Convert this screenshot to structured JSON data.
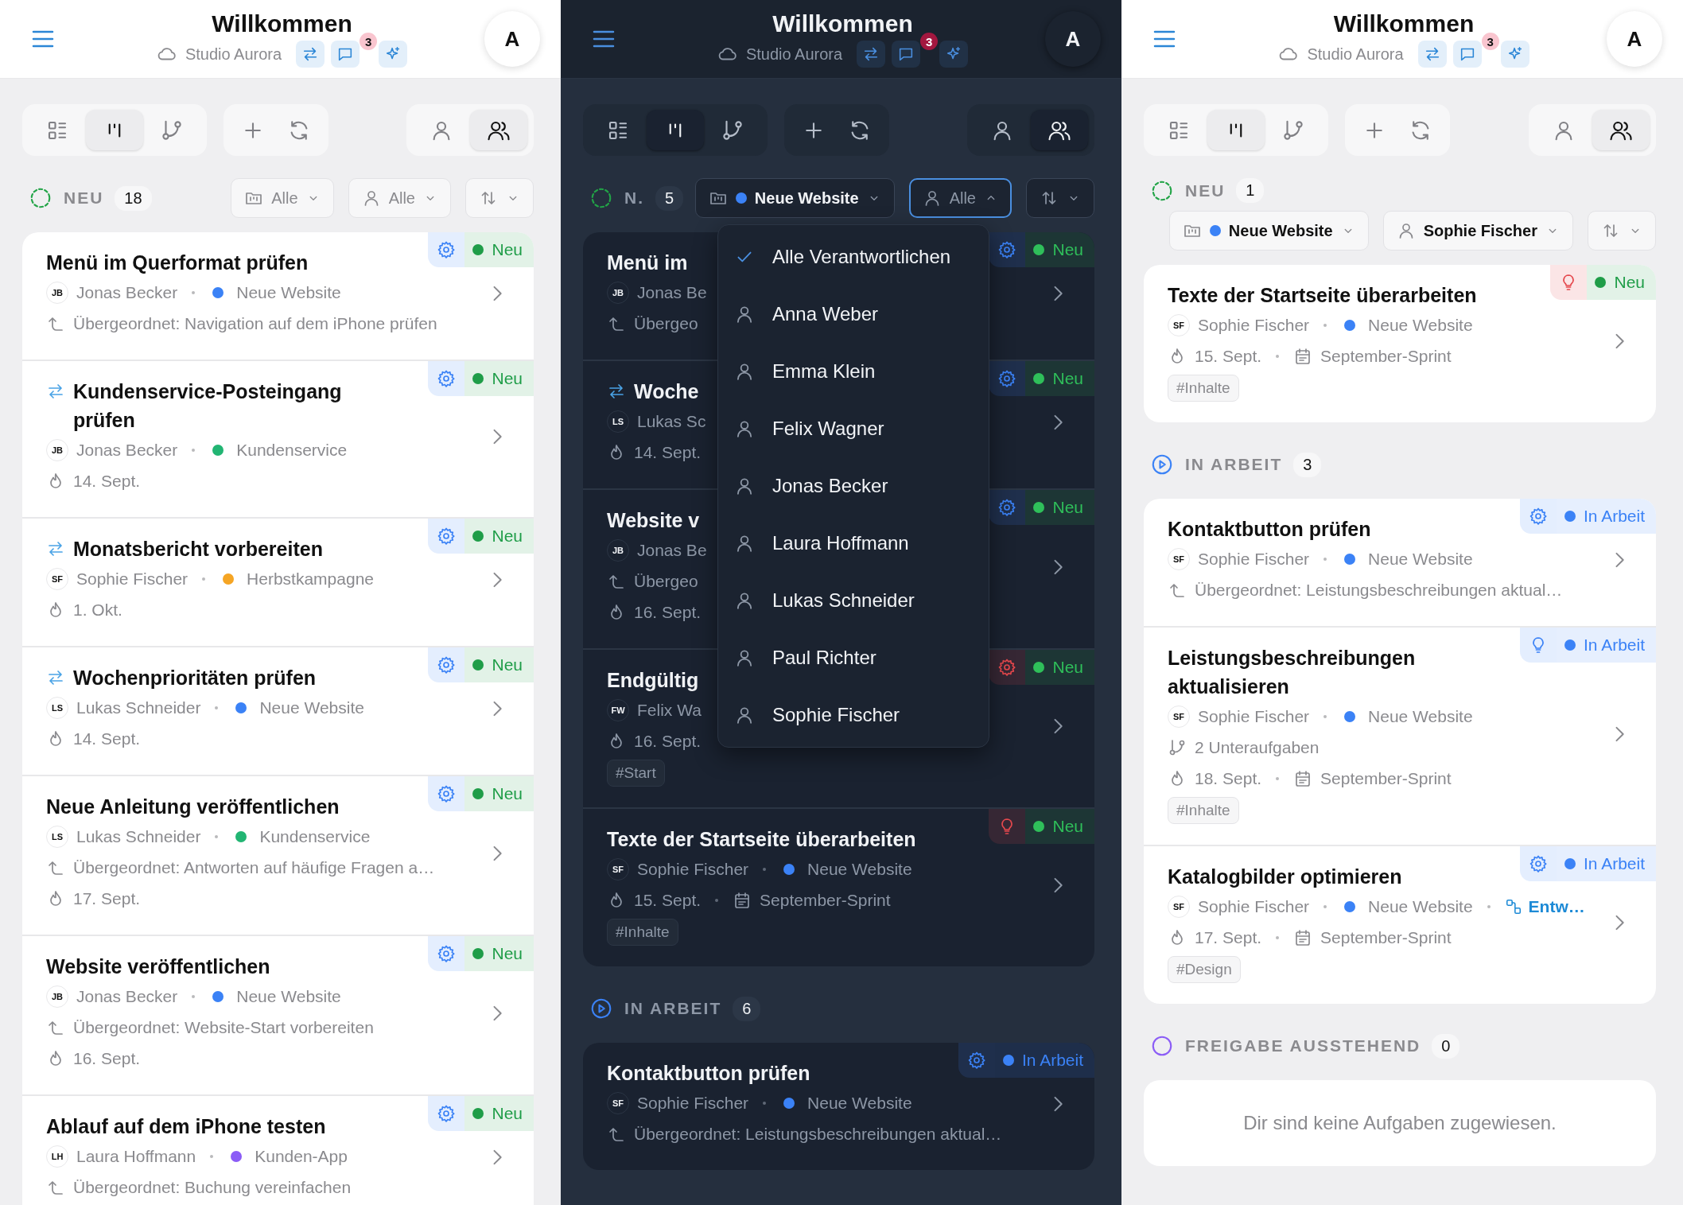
{
  "screens": [
    {
      "dark": false,
      "header": {
        "title": "Willkommen",
        "workspace": "Studio Aurora",
        "notifications": "3",
        "avatar": "A"
      },
      "toolbar": {
        "views": [
          {
            "kind": "list",
            "selected": false
          },
          {
            "kind": "board",
            "selected": true
          },
          {
            "kind": "branch",
            "selected": false
          }
        ],
        "scopes": [
          {
            "kind": "single",
            "selected": false
          },
          {
            "kind": "team",
            "selected": true
          }
        ]
      },
      "sections": [
        {
          "kind": "new",
          "label": "NEU",
          "count": "18",
          "filters": [
            {
              "kind": "project",
              "value": "Alle",
              "set": false,
              "open": false
            },
            {
              "kind": "assignee",
              "value": "Alle",
              "set": false,
              "open": false
            },
            {
              "kind": "sort",
              "open": false
            }
          ],
          "cards": [
            {
              "title": "Menü im Querformat prüfen",
              "recurring": false,
              "badge": {
                "kind": "gear",
                "color": "#3b82f6"
              },
              "status": {
                "label": "Neu",
                "color": "#1f9d48"
              },
              "owner": {
                "initials": "JB",
                "name": "Jonas Becker"
              },
              "project": {
                "name": "Neue Website",
                "color": "#3b82f6"
              },
              "parent": "Übergeordnet: Navigation auf dem iPhone prüfen"
            },
            {
              "title": "Kundenservice-Posteingang prüfen",
              "recurring": true,
              "badge": {
                "kind": "gear",
                "color": "#3b82f6"
              },
              "status": {
                "label": "Neu",
                "color": "#1f9d48"
              },
              "owner": {
                "initials": "JB",
                "name": "Jonas Becker"
              },
              "project": {
                "name": "Kundenservice",
                "color": "#22b573"
              },
              "due": "14. Sept."
            },
            {
              "title": "Monatsbericht vorbereiten",
              "recurring": true,
              "badge": {
                "kind": "gear",
                "color": "#3b82f6"
              },
              "status": {
                "label": "Neu",
                "color": "#1f9d48"
              },
              "owner": {
                "initials": "SF",
                "name": "Sophie Fischer"
              },
              "project": {
                "name": "Herbstkampagne",
                "color": "#f5a524"
              },
              "due": "1. Okt."
            },
            {
              "title": "Wochenprioritäten prüfen",
              "recurring": true,
              "badge": {
                "kind": "gear",
                "color": "#3b82f6"
              },
              "status": {
                "label": "Neu",
                "color": "#1f9d48"
              },
              "owner": {
                "initials": "LS",
                "name": "Lukas Schneider"
              },
              "project": {
                "name": "Neue Website",
                "color": "#3b82f6"
              },
              "due": "14. Sept."
            },
            {
              "title": "Neue Anleitung veröffentlichen",
              "recurring": false,
              "badge": {
                "kind": "gear",
                "color": "#3b82f6"
              },
              "status": {
                "label": "Neu",
                "color": "#1f9d48"
              },
              "owner": {
                "initials": "LS",
                "name": "Lukas Schneider"
              },
              "project": {
                "name": "Kundenservice",
                "color": "#22b573"
              },
              "parent": "Übergeordnet: Antworten auf häufige Fragen a…",
              "due": "17. Sept."
            },
            {
              "title": "Website veröffentlichen",
              "recurring": false,
              "badge": {
                "kind": "gear",
                "color": "#3b82f6"
              },
              "status": {
                "label": "Neu",
                "color": "#1f9d48"
              },
              "owner": {
                "initials": "JB",
                "name": "Jonas Becker"
              },
              "project": {
                "name": "Neue Website",
                "color": "#3b82f6"
              },
              "parent": "Übergeordnet: Website-Start vorbereiten",
              "due": "16. Sept."
            },
            {
              "title": "Ablauf auf dem iPhone testen",
              "recurring": false,
              "badge": {
                "kind": "gear",
                "color": "#3b82f6"
              },
              "status": {
                "label": "Neu",
                "color": "#1f9d48"
              },
              "owner": {
                "initials": "LH",
                "name": "Laura Hoffmann"
              },
              "project": {
                "name": "Kunden-App",
                "color": "#8b5cf6"
              },
              "parent": "Übergeordnet: Buchung vereinfachen"
            }
          ]
        }
      ]
    },
    {
      "dark": true,
      "header": {
        "title": "Willkommen",
        "workspace": "Studio Aurora",
        "notifications": "3",
        "avatar": "A"
      },
      "toolbar": {
        "views": [
          {
            "kind": "list",
            "selected": false
          },
          {
            "kind": "board",
            "selected": true
          },
          {
            "kind": "branch",
            "selected": false
          }
        ],
        "scopes": [
          {
            "kind": "single",
            "selected": false
          },
          {
            "kind": "team",
            "selected": true
          }
        ]
      },
      "sections": [
        {
          "kind": "new",
          "label": "N.",
          "count": "5",
          "filters": [
            {
              "kind": "project",
              "value": "Neue Website",
              "color": "#3b82f6",
              "set": true,
              "open": false
            },
            {
              "kind": "assignee",
              "value": "Alle",
              "set": false,
              "open": true,
              "menu": [
                {
                  "label": "Alle Verantwortlichen",
                  "selected": true
                },
                {
                  "label": "Anna Weber",
                  "selected": false
                },
                {
                  "label": "Emma Klein",
                  "selected": false
                },
                {
                  "label": "Felix Wagner",
                  "selected": false
                },
                {
                  "label": "Jonas Becker",
                  "selected": false
                },
                {
                  "label": "Laura Hoffmann",
                  "selected": false
                },
                {
                  "label": "Lukas Schneider",
                  "selected": false
                },
                {
                  "label": "Paul Richter",
                  "selected": false
                },
                {
                  "label": "Sophie Fischer",
                  "selected": false
                }
              ]
            },
            {
              "kind": "sort",
              "open": false
            }
          ],
          "cards": [
            {
              "title": "Menü im",
              "recurring": false,
              "badge": {
                "kind": "gear",
                "color": "#3b82f6"
              },
              "status": {
                "label": "Neu",
                "color": "#2fbf5a"
              },
              "owner": {
                "initials": "JB",
                "name": "Jonas Be"
              },
              "parent": "Übergeo"
            },
            {
              "title": "Woche",
              "recurring": true,
              "badge": {
                "kind": "gear",
                "color": "#3b82f6"
              },
              "status": {
                "label": "Neu",
                "color": "#2fbf5a"
              },
              "owner": {
                "initials": "LS",
                "name": "Lukas Sc"
              },
              "due": "14. Sept."
            },
            {
              "title": "Website v",
              "recurring": false,
              "badge": {
                "kind": "gear",
                "color": "#3b82f6"
              },
              "status": {
                "label": "Neu",
                "color": "#2fbf5a"
              },
              "owner": {
                "initials": "JB",
                "name": "Jonas Be"
              },
              "parent": "Übergeo",
              "due": "16. Sept."
            },
            {
              "title": "Endgültig",
              "recurring": false,
              "badge": {
                "kind": "gear",
                "color": "#e5484d"
              },
              "status": {
                "label": "Neu",
                "color": "#2fbf5a"
              },
              "owner": {
                "initials": "FW",
                "name": "Felix Wa"
              },
              "due": "16. Sept.",
              "tags": [
                "#Start"
              ]
            },
            {
              "title": "Texte der Startseite überarbeiten",
              "recurring": false,
              "badge": {
                "kind": "bulb",
                "color": "#e5484d"
              },
              "status": {
                "label": "Neu",
                "color": "#2fbf5a"
              },
              "owner": {
                "initials": "SF",
                "name": "Sophie Fischer"
              },
              "project": {
                "name": "Neue Website",
                "color": "#3b82f6"
              },
              "due": "15. Sept.",
              "sprint": "September-Sprint",
              "tags": [
                "#Inhalte"
              ]
            }
          ]
        },
        {
          "kind": "progress",
          "label": "IN ARBEIT",
          "count": "6",
          "cards": [
            {
              "title": "Kontaktbutton prüfen",
              "recurring": false,
              "badge": {
                "kind": "gear",
                "color": "#3b82f6"
              },
              "status": {
                "label": "In Arbeit",
                "color": "#3b82f6"
              },
              "owner": {
                "initials": "SF",
                "name": "Sophie Fischer"
              },
              "project": {
                "name": "Neue Website",
                "color": "#3b82f6"
              },
              "parent": "Übergeordnet: Leistungsbeschreibungen aktual…"
            }
          ]
        }
      ]
    },
    {
      "dark": false,
      "header": {
        "title": "Willkommen",
        "workspace": "Studio Aurora",
        "notifications": "3",
        "avatar": "A"
      },
      "toolbar": {
        "views": [
          {
            "kind": "list",
            "selected": false
          },
          {
            "kind": "board",
            "selected": true
          },
          {
            "kind": "branch",
            "selected": false
          }
        ],
        "scopes": [
          {
            "kind": "single",
            "selected": false
          },
          {
            "kind": "team",
            "selected": true
          }
        ]
      },
      "sections": [
        {
          "kind": "new",
          "label": "NEU",
          "count": "1",
          "filters": [
            {
              "kind": "project",
              "value": "Neue Website",
              "color": "#3b82f6",
              "set": true,
              "open": false
            },
            {
              "kind": "assignee",
              "value": "Sophie Fischer",
              "set": true,
              "open": false
            },
            {
              "kind": "sort",
              "open": false
            }
          ],
          "cards": [
            {
              "title": "Texte der Startseite überarbeiten",
              "recurring": false,
              "badge": {
                "kind": "bulb",
                "color": "#e5484d"
              },
              "status": {
                "label": "Neu",
                "color": "#1f9d48"
              },
              "owner": {
                "initials": "SF",
                "name": "Sophie Fischer"
              },
              "project": {
                "name": "Neue Website",
                "color": "#3b82f6"
              },
              "due": "15. Sept.",
              "sprint": "September-Sprint",
              "tags": [
                "#Inhalte"
              ]
            }
          ]
        },
        {
          "kind": "progress",
          "label": "IN ARBEIT",
          "count": "3",
          "cards": [
            {
              "title": "Kontaktbutton prüfen",
              "recurring": false,
              "badge": {
                "kind": "gear",
                "color": "#3b82f6"
              },
              "status": {
                "label": "In Arbeit",
                "color": "#3b82f6"
              },
              "owner": {
                "initials": "SF",
                "name": "Sophie Fischer"
              },
              "project": {
                "name": "Neue Website",
                "color": "#3b82f6"
              },
              "parent": "Übergeordnet: Leistungsbeschreibungen aktual…"
            },
            {
              "title": "Leistungsbeschreibungen aktualisieren",
              "recurring": false,
              "badge": {
                "kind": "bulb",
                "color": "#3b82f6"
              },
              "status": {
                "label": "In Arbeit",
                "color": "#3b82f6"
              },
              "owner": {
                "initials": "SF",
                "name": "Sophie Fischer"
              },
              "project": {
                "name": "Neue Website",
                "color": "#3b82f6"
              },
              "subtasks": "2 Unteraufgaben",
              "due": "18. Sept.",
              "sprint": "September-Sprint",
              "tags": [
                "#Inhalte"
              ]
            },
            {
              "title": "Katalogbilder optimieren",
              "recurring": false,
              "badge": {
                "kind": "gear",
                "color": "#3b82f6"
              },
              "status": {
                "label": "In Arbeit",
                "color": "#3b82f6"
              },
              "owner": {
                "initials": "SF",
                "name": "Sophie Fischer"
              },
              "project": {
                "name": "Neue Website",
                "color": "#3b82f6"
              },
              "link": "Entw…",
              "due": "17. Sept.",
              "sprint": "September-Sprint",
              "tags": [
                "#Design"
              ]
            }
          ]
        },
        {
          "kind": "pending",
          "label": "FREIGABE AUSSTEHEND",
          "count": "0",
          "empty": "Dir sind keine Aufgaben zugewiesen."
        }
      ]
    }
  ]
}
